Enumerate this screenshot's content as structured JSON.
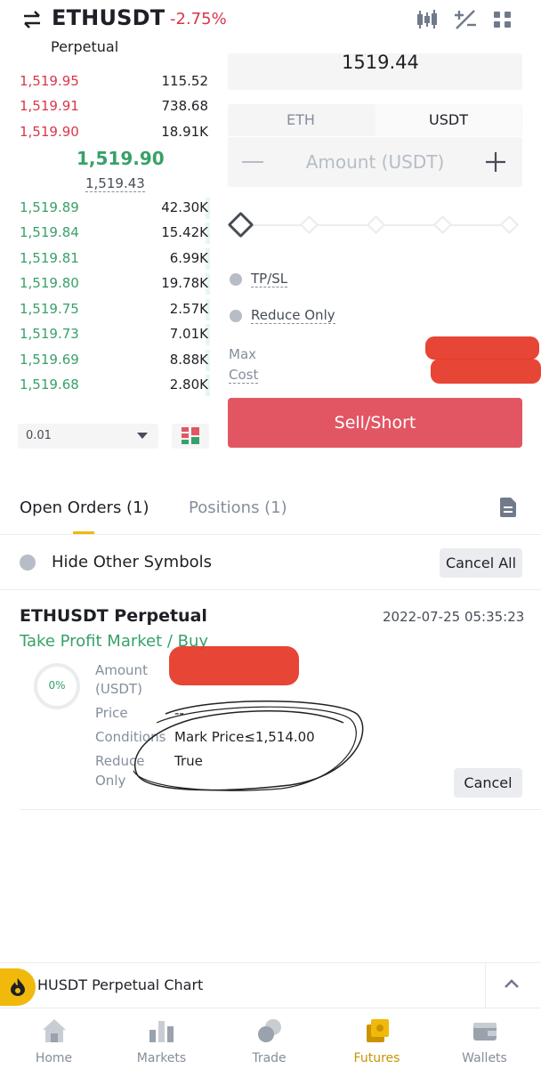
{
  "header": {
    "pair": "ETHUSDT",
    "change": "-2.75%",
    "contract_type": "Perpetual",
    "icons": [
      "swap-icon",
      "candlestick-chart-icon",
      "percent-calc-icon",
      "more-icon"
    ]
  },
  "order_book": {
    "asks": [
      {
        "price": "1,519.95",
        "qty": "115.52"
      },
      {
        "price": "1,519.91",
        "qty": "738.68"
      },
      {
        "price": "1,519.90",
        "qty": "18.91K"
      }
    ],
    "last_price": "1,519.90",
    "mark_price": "1,519.43",
    "bids": [
      {
        "price": "1,519.89",
        "qty": "42.30K"
      },
      {
        "price": "1,519.84",
        "qty": "15.42K"
      },
      {
        "price": "1,519.81",
        "qty": "6.99K"
      },
      {
        "price": "1,519.80",
        "qty": "19.78K"
      },
      {
        "price": "1,519.75",
        "qty": "2.57K"
      },
      {
        "price": "1,519.73",
        "qty": "7.01K"
      },
      {
        "price": "1,519.69",
        "qty": "8.88K"
      },
      {
        "price": "1,519.68",
        "qty": "2.80K"
      }
    ],
    "depth_step": "0.01"
  },
  "order_form": {
    "price_value": "1519.44",
    "unit_tabs": [
      "ETH",
      "USDT"
    ],
    "active_unit": "USDT",
    "amount_placeholder": "Amount (USDT)",
    "tp_sl_label": "TP/SL",
    "reduce_only_label": "Reduce Only",
    "max_label": "Max",
    "cost_label": "Cost",
    "sell_button": "Sell/Short"
  },
  "tabs": {
    "open_orders": "Open Orders (1)",
    "positions": "Positions (1)"
  },
  "filter": {
    "hide_other_symbols": "Hide Other Symbols",
    "cancel_all": "Cancel All"
  },
  "order": {
    "symbol": "ETHUSDT Perpetual",
    "time": "2022-07-25 05:35:23",
    "type": "Take Profit Market / Buy",
    "filled_percent": "0%",
    "amount_label_1": "Amount",
    "amount_label_2": "(USDT)",
    "price_label": "Price",
    "price_value": "--",
    "conditions_label": "Conditions",
    "conditions_value": "Mark Price≤1,514.00",
    "reduce_label_1": "Reduce",
    "reduce_label_2": "Only",
    "reduce_value": "True",
    "cancel_button": "Cancel"
  },
  "chart_bar": {
    "label": "HUSDT Perpetual  Chart"
  },
  "nav": {
    "items": [
      {
        "label": "Home",
        "icon": "home-icon"
      },
      {
        "label": "Markets",
        "icon": "markets-icon"
      },
      {
        "label": "Trade",
        "icon": "trade-icon"
      },
      {
        "label": "Futures",
        "icon": "futures-icon"
      },
      {
        "label": "Wallets",
        "icon": "wallet-icon"
      }
    ],
    "active": "Futures"
  },
  "colors": {
    "sell": "#d9364a",
    "buy": "#38a168",
    "accent": "#f0b90b"
  }
}
